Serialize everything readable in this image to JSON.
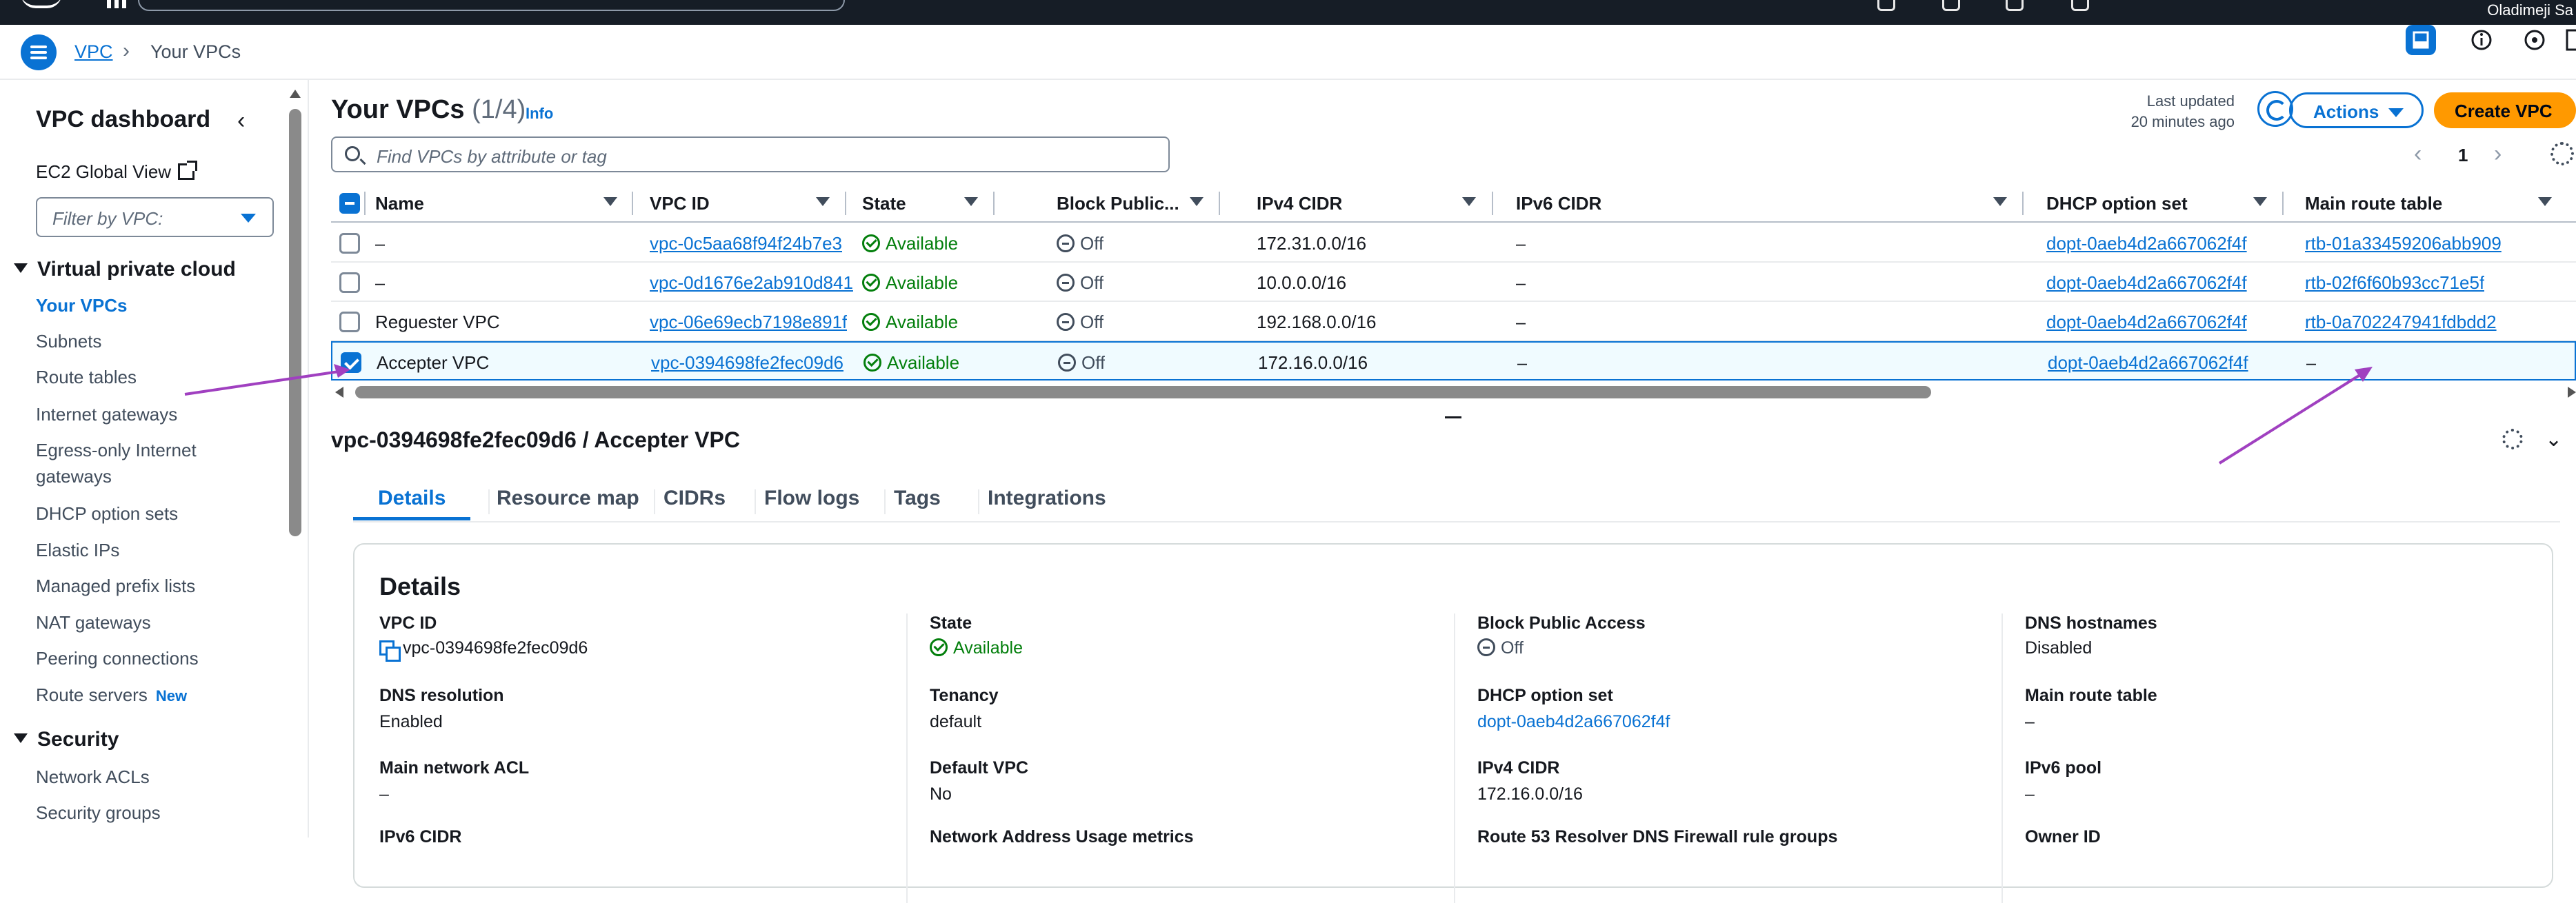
{
  "topbar": {
    "user_name": "Oladimeji Sa"
  },
  "breadcrumb": {
    "parent": "VPC",
    "current": "Your VPCs"
  },
  "sidebar": {
    "title": "VPC dashboard",
    "ec2_global_view": "EC2 Global View",
    "filter_placeholder": "Filter by VPC:",
    "sections": [
      {
        "title": "Virtual private cloud"
      },
      {
        "title": "Security"
      }
    ],
    "items": [
      {
        "label": "Your VPCs"
      },
      {
        "label": "Subnets"
      },
      {
        "label": "Route tables"
      },
      {
        "label": "Internet gateways"
      },
      {
        "label": "Egress-only Internet gateways"
      },
      {
        "label": "DHCP option sets"
      },
      {
        "label": "Elastic IPs"
      },
      {
        "label": "Managed prefix lists"
      },
      {
        "label": "NAT gateways"
      },
      {
        "label": "Peering connections"
      },
      {
        "label": "Route servers",
        "badge": "New"
      },
      {
        "label": "Network ACLs"
      },
      {
        "label": "Security groups"
      }
    ]
  },
  "main": {
    "title": "Your VPCs",
    "count": "(1/4)",
    "info": "Info",
    "last_updated_label": "Last updated",
    "last_updated_value": "20 minutes ago",
    "actions_label": "Actions",
    "create_label": "Create VPC",
    "search_placeholder": "Find VPCs by attribute or tag",
    "page_number": "1"
  },
  "table": {
    "columns": [
      "Name",
      "VPC ID",
      "State",
      "Block Public...",
      "IPv4 CIDR",
      "IPv6 CIDR",
      "DHCP option set",
      "Main route table"
    ],
    "rows": [
      {
        "name": "–",
        "vpc_id": "vpc-0c5aa68f94f24b7e3",
        "state": "Available",
        "block": "Off",
        "ipv4": "172.31.0.0/16",
        "ipv6": "–",
        "dhcp": "dopt-0aeb4d2a667062f4f",
        "route": "rtb-01a33459206abb909",
        "selected": false
      },
      {
        "name": "–",
        "vpc_id": "vpc-0d1676e2ab910d841",
        "state": "Available",
        "block": "Off",
        "ipv4": "10.0.0.0/16",
        "ipv6": "–",
        "dhcp": "dopt-0aeb4d2a667062f4f",
        "route": "rtb-02f6f60b93cc71e5f",
        "selected": false
      },
      {
        "name": "Reguester VPC",
        "vpc_id": "vpc-06e69ecb7198e891f",
        "state": "Available",
        "block": "Off",
        "ipv4": "192.168.0.0/16",
        "ipv6": "–",
        "dhcp": "dopt-0aeb4d2a667062f4f",
        "route": "rtb-0a702247941fdbdd2",
        "selected": false
      },
      {
        "name": "Accepter VPC",
        "vpc_id": "vpc-0394698fe2fec09d6",
        "state": "Available",
        "block": "Off",
        "ipv4": "172.16.0.0/16",
        "ipv6": "–",
        "dhcp": "dopt-0aeb4d2a667062f4f",
        "route": "–",
        "selected": true
      }
    ]
  },
  "detail": {
    "split_title": "vpc-0394698fe2fec09d6 / Accepter VPC",
    "tabs": [
      "Details",
      "Resource map",
      "CIDRs",
      "Flow logs",
      "Tags",
      "Integrations"
    ],
    "panel_title": "Details",
    "fields": [
      {
        "key": "VPC ID",
        "value": "vpc-0394698fe2fec09d6"
      },
      {
        "key": "State",
        "value": "Available"
      },
      {
        "key": "Block Public Access",
        "value": "Off"
      },
      {
        "key": "DNS hostnames",
        "value": "Disabled"
      },
      {
        "key": "DNS resolution",
        "value": "Enabled"
      },
      {
        "key": "Tenancy",
        "value": "default"
      },
      {
        "key": "DHCP option set",
        "value": "dopt-0aeb4d2a667062f4f"
      },
      {
        "key": "Main route table",
        "value": "–"
      },
      {
        "key": "Main network ACL",
        "value": "–"
      },
      {
        "key": "Default VPC",
        "value": "No"
      },
      {
        "key": "IPv4 CIDR",
        "value": "172.16.0.0/16"
      },
      {
        "key": "IPv6 pool",
        "value": "–"
      },
      {
        "key": "IPv6 CIDR",
        "value": ""
      },
      {
        "key": "Network Address Usage metrics",
        "value": ""
      },
      {
        "key": "Route 53 Resolver DNS Firewall rule groups",
        "value": ""
      },
      {
        "key": "Owner ID",
        "value": ""
      }
    ]
  },
  "colors": {
    "accent": "#0972d3",
    "create_button": "#ff9900",
    "status_ok": "#037f0c",
    "annotation_arrow": "#a040c0"
  }
}
